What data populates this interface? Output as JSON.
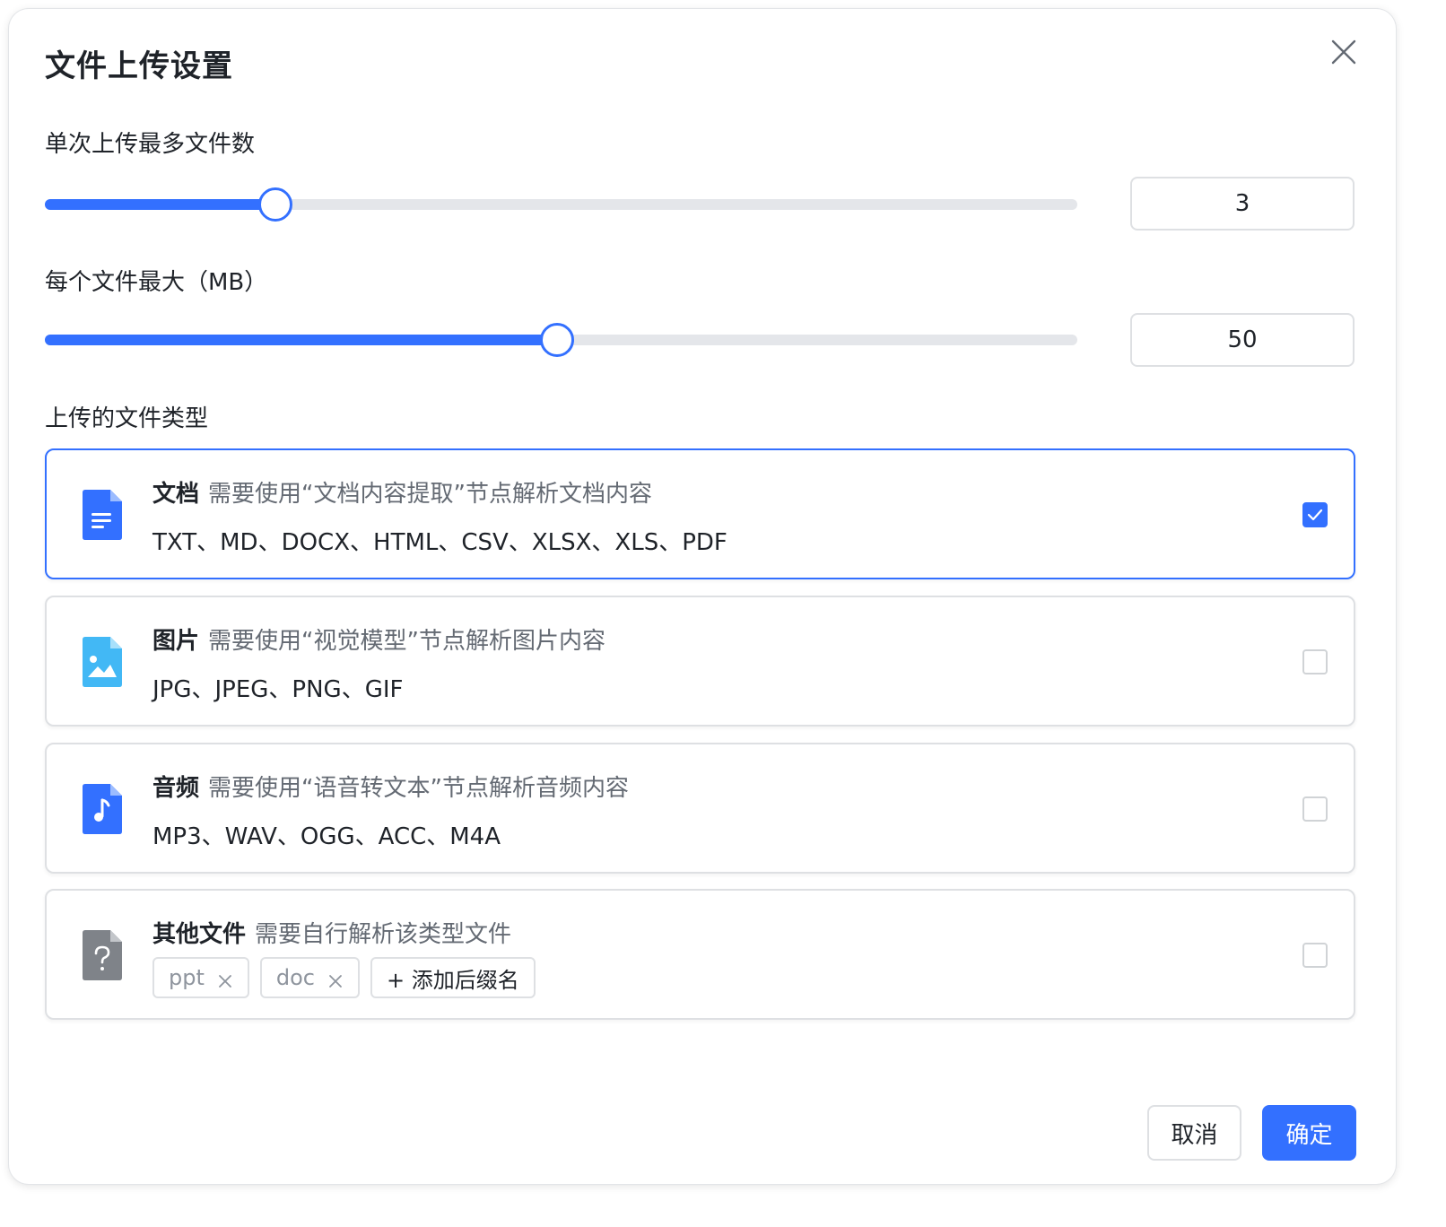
{
  "dialog": {
    "title": "文件上传设置",
    "close_icon": "close-icon"
  },
  "max_files": {
    "label": "单次上传最多文件数",
    "value": "3",
    "slider_fraction": 0.222
  },
  "max_size": {
    "label": "每个文件最大（MB）",
    "value": "50",
    "slider_fraction": 0.495
  },
  "file_types": {
    "label": "上传的文件类型",
    "items": [
      {
        "name": "文档",
        "desc": "需要使用“文档内容提取”节点解析文档内容",
        "extensions": "TXT、MD、DOCX、HTML、CSV、XLSX、XLS、PDF",
        "icon": "document-file-icon",
        "checked": true
      },
      {
        "name": "图片",
        "desc": "需要使用“视觉模型”节点解析图片内容",
        "extensions": "JPG、JPEG、PNG、GIF",
        "icon": "image-file-icon",
        "checked": false
      },
      {
        "name": "音频",
        "desc": "需要使用“语音转文本”节点解析音频内容",
        "extensions": "MP3、WAV、OGG、ACC、M4A",
        "icon": "audio-file-icon",
        "checked": false
      },
      {
        "name": "其他文件",
        "desc": "需要自行解析该类型文件",
        "tags": [
          "ppt",
          "doc"
        ],
        "add_label": "+ 添加后缀名",
        "icon": "unknown-file-icon",
        "checked": false
      }
    ]
  },
  "footer": {
    "cancel_label": "取消",
    "confirm_label": "确定"
  },
  "colors": {
    "accent": "#3370ff",
    "image_icon": "#42b8f5",
    "other_icon": "#7f8389"
  }
}
